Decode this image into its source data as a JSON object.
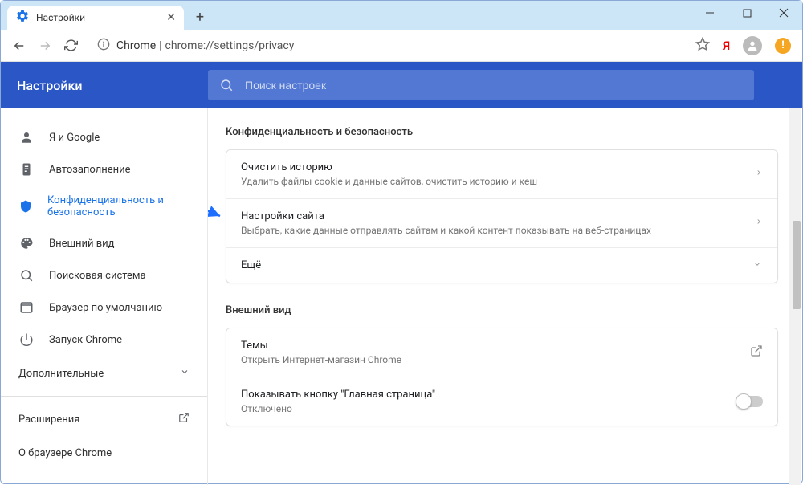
{
  "tab": {
    "title": "Настройки"
  },
  "url": {
    "host": "Chrome",
    "path": "chrome://settings/privacy"
  },
  "header": {
    "title": "Настройки"
  },
  "search": {
    "placeholder": "Поиск настроек"
  },
  "sidebar": {
    "items": [
      {
        "label": "Я и Google"
      },
      {
        "label": "Автозаполнение"
      },
      {
        "label": "Конфиденциальность и безопасность"
      },
      {
        "label": "Внешний вид"
      },
      {
        "label": "Поисковая система"
      },
      {
        "label": "Браузер по умолчанию"
      },
      {
        "label": "Запуск Chrome"
      }
    ],
    "advanced": "Дополнительные",
    "extensions": "Расширения",
    "about": "О браузере Chrome"
  },
  "main": {
    "section1_title": "Конфиденциальность и безопасность",
    "rows1": [
      {
        "title": "Очистить историю",
        "sub": "Удалить файлы cookie и данные сайтов, очистить историю и кеш"
      },
      {
        "title": "Настройки сайта",
        "sub": "Выбрать, какие данные отправлять сайтам и какой контент показывать на веб-страницах"
      },
      {
        "title": "Ещё"
      }
    ],
    "section2_title": "Внешний вид",
    "rows2": [
      {
        "title": "Темы",
        "sub": "Открыть Интернет-магазин Chrome"
      },
      {
        "title": "Показывать кнопку \"Главная страница\"",
        "sub": "Отключено"
      }
    ]
  }
}
